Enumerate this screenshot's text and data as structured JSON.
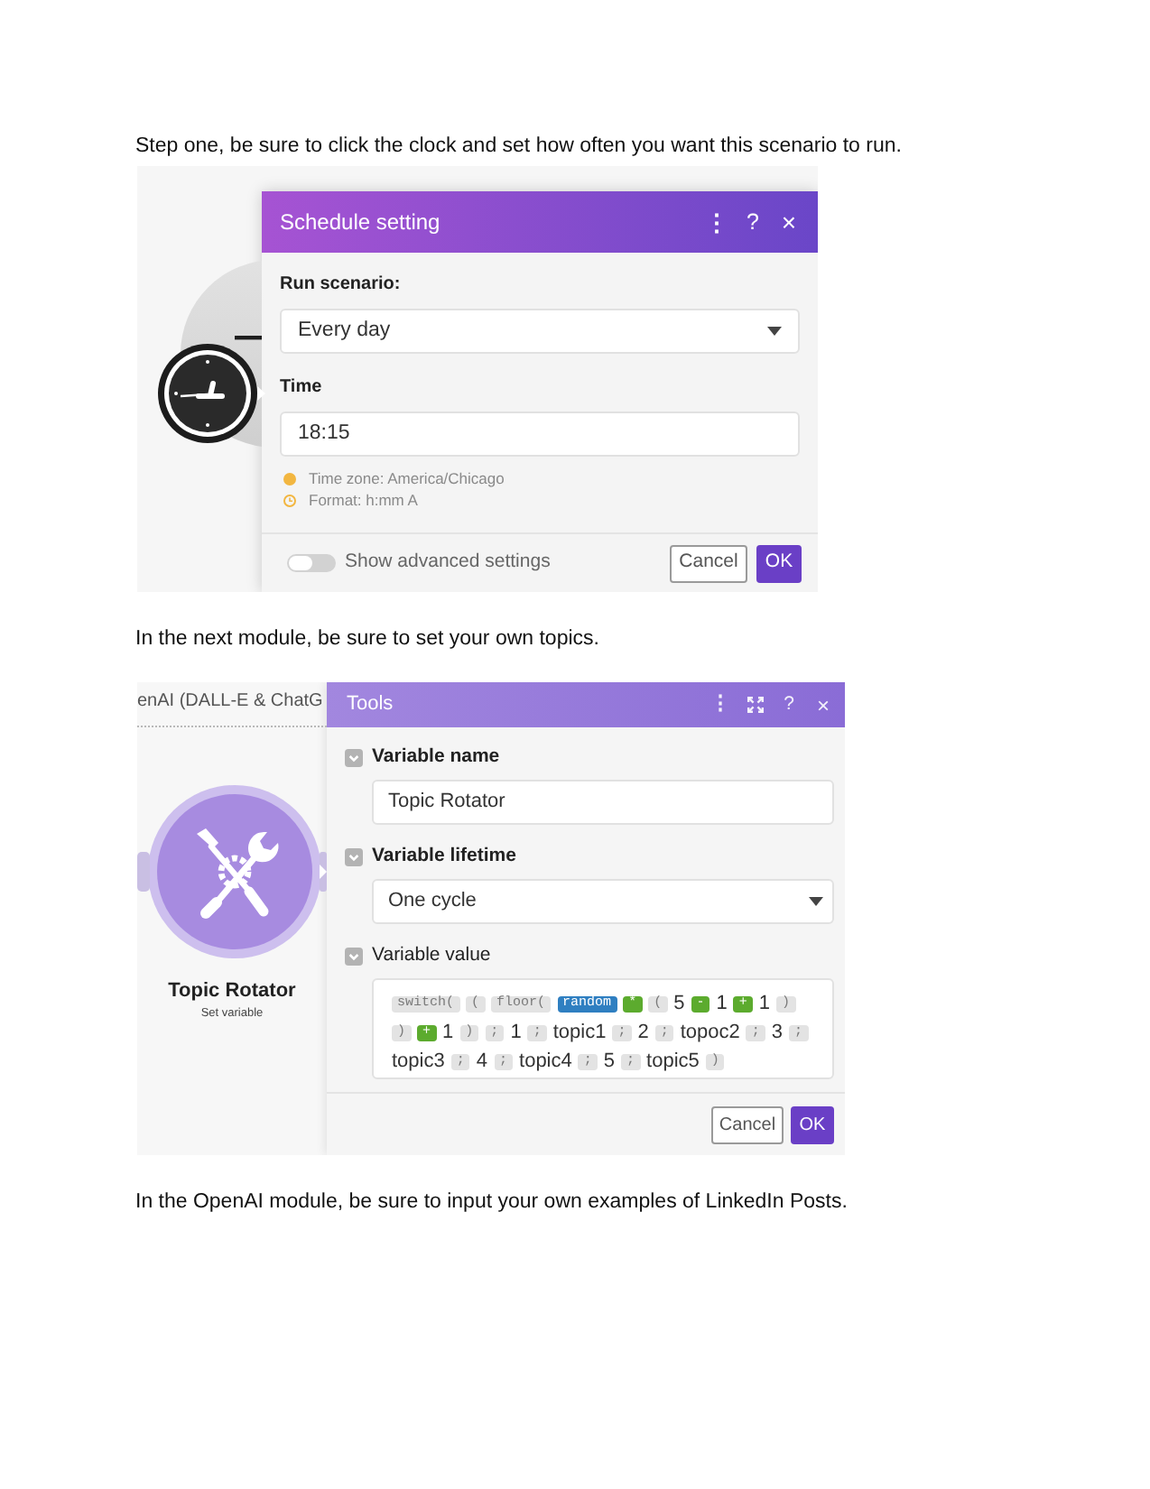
{
  "step_one": {
    "text": "Step one, be sure to click the clock and set how often you want this scenario to run."
  },
  "schedule_screenshot": {
    "dialog": {
      "title": "Schedule setting",
      "header_buttons": [
        {
          "kind": "menu",
          "label": "⋮"
        },
        {
          "kind": "help",
          "label": "?"
        },
        {
          "kind": "close",
          "label": "×"
        }
      ],
      "fields": [
        {
          "kind": "select",
          "label": "Run scenario:",
          "value": "Every day"
        },
        {
          "kind": "text",
          "label": "Time",
          "value": "18:15"
        }
      ],
      "hints": [
        {
          "kind": "info",
          "text": "Time zone: America/Chicago"
        },
        {
          "kind": "clock",
          "text": "Format: h:mm A"
        }
      ],
      "advanced_settings": {
        "label": "Show advanced settings",
        "on": false
      },
      "buttons": [
        {
          "kind": "secondary",
          "label": "Cancel"
        },
        {
          "kind": "primary",
          "label": "OK"
        }
      ]
    }
  },
  "step_two": {
    "text": "In the next module, be sure to set your own topics."
  },
  "tools_screenshot": {
    "link_label": "enAI (DALL-E & ChatG",
    "module": {
      "title": "Topic Rotator",
      "subtitle": "Set variable"
    },
    "dialog": {
      "title": "Tools",
      "header_buttons": [
        {
          "kind": "menu",
          "label": "⋮"
        },
        {
          "kind": "expand"
        },
        {
          "kind": "help",
          "label": "?"
        },
        {
          "kind": "close",
          "label": "×"
        }
      ],
      "fields": [
        {
          "kind": "text",
          "label": "Variable name",
          "required": true,
          "value": "Topic Rotator"
        },
        {
          "kind": "select",
          "label": "Variable lifetime",
          "required": true,
          "value": "One cycle"
        },
        {
          "kind": "formula",
          "label": "Variable value",
          "required": false,
          "tokens": [
            {
              "kind": "function",
              "text": "switch("
            },
            {
              "kind": "bracket",
              "text": "("
            },
            {
              "kind": "function",
              "text": "floor("
            },
            {
              "kind": "keyword",
              "text": "random"
            },
            {
              "kind": "operator",
              "text": "*"
            },
            {
              "kind": "bracket",
              "text": "("
            },
            {
              "kind": "text",
              "text": "5"
            },
            {
              "kind": "operator",
              "text": "-"
            },
            {
              "kind": "text",
              "text": "1"
            },
            {
              "kind": "operator",
              "text": "+"
            },
            {
              "kind": "text",
              "text": "1"
            },
            {
              "kind": "bracket",
              "text": ")"
            },
            {
              "kind": "bracket",
              "text": ")"
            },
            {
              "kind": "operator",
              "text": "+"
            },
            {
              "kind": "text",
              "text": "1"
            },
            {
              "kind": "bracket",
              "text": ")"
            },
            {
              "kind": "separator",
              "text": ";"
            },
            {
              "kind": "text",
              "text": "1"
            },
            {
              "kind": "separator",
              "text": ";"
            },
            {
              "kind": "text",
              "text": "topic1"
            },
            {
              "kind": "separator",
              "text": ";"
            },
            {
              "kind": "text",
              "text": "2"
            },
            {
              "kind": "separator",
              "text": ";"
            },
            {
              "kind": "text",
              "text": "topoc2"
            },
            {
              "kind": "separator",
              "text": ";"
            },
            {
              "kind": "text",
              "text": "3"
            },
            {
              "kind": "separator",
              "text": ";"
            },
            {
              "kind": "text",
              "text": "topic3"
            },
            {
              "kind": "separator",
              "text": ";"
            },
            {
              "kind": "text",
              "text": "4"
            },
            {
              "kind": "separator",
              "text": ";"
            },
            {
              "kind": "text",
              "text": "topic4"
            },
            {
              "kind": "separator",
              "text": ";"
            },
            {
              "kind": "text",
              "text": "5"
            },
            {
              "kind": "separator",
              "text": ";"
            },
            {
              "kind": "text",
              "text": "topic5"
            },
            {
              "kind": "bracket",
              "text": ")"
            }
          ]
        }
      ],
      "buttons": [
        {
          "kind": "secondary",
          "label": "Cancel"
        },
        {
          "kind": "primary",
          "label": "OK"
        }
      ]
    }
  },
  "step_three": {
    "text": "In the OpenAI module, be sure to input your own examples of LinkedIn Posts."
  }
}
